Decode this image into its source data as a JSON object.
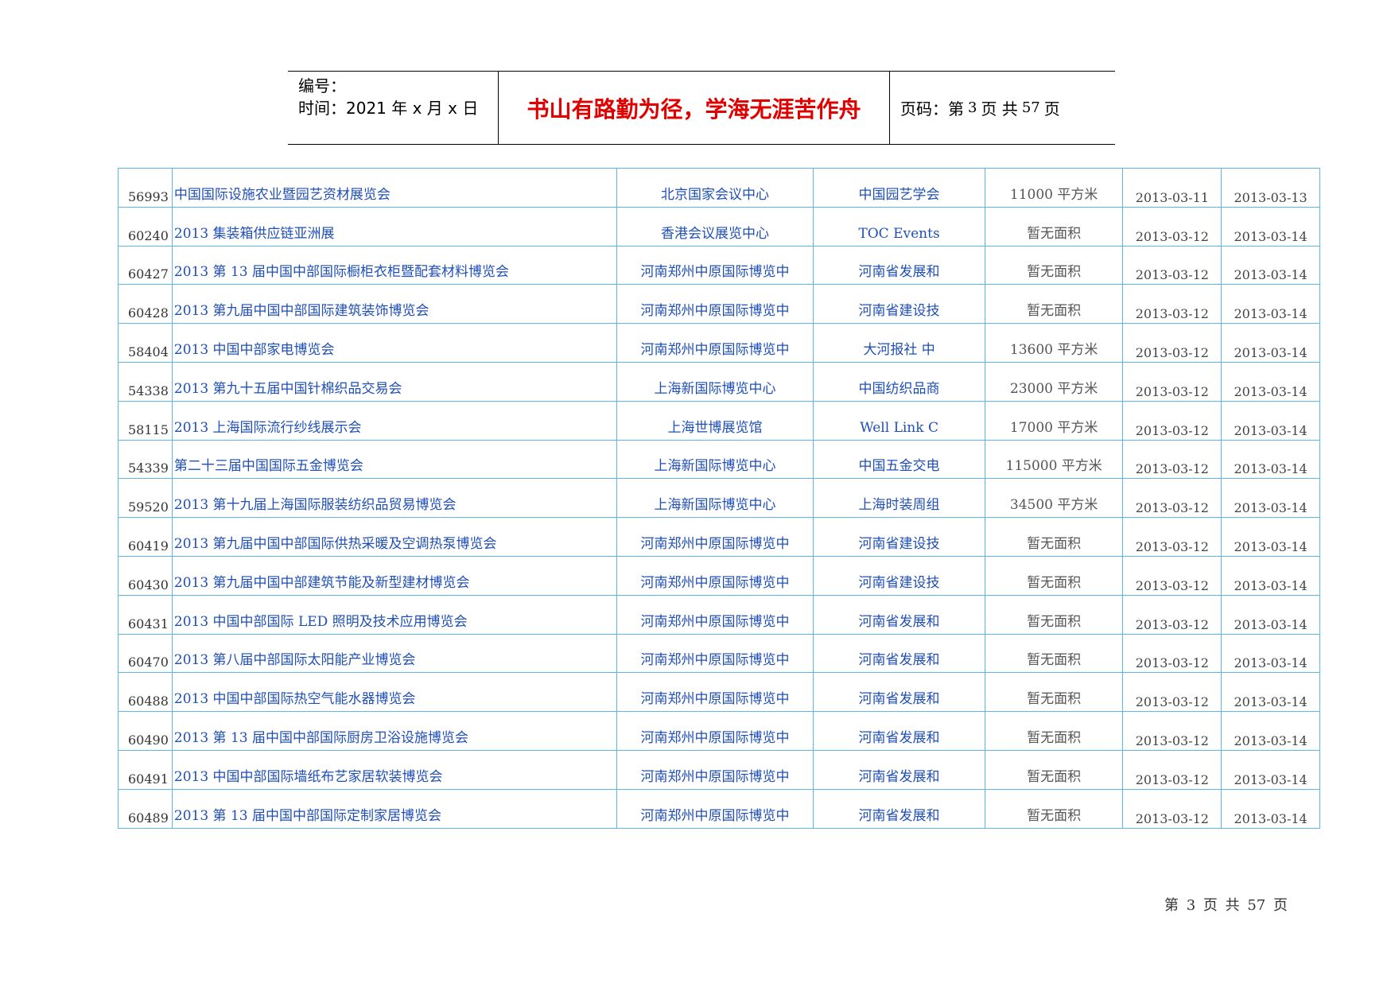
{
  "header": {
    "number_label": "编号：",
    "date_label": "时间：2021 年 x 月 x 日",
    "motto": "书山有路勤为径，学海无涯苦作舟",
    "page_prefix": "页码：第",
    "page_current": "3",
    "page_middle": "页  共",
    "page_total": "57",
    "page_suffix": "页"
  },
  "rows": [
    {
      "id": "56993",
      "name": "中国国际设施农业暨园艺资材展览会",
      "venue": "北京国家会议中心",
      "organizer": "中国园艺学会",
      "area": "11000 平方米",
      "start": "2013-03-11",
      "end": "2013-03-13"
    },
    {
      "id": "60240",
      "name": "2013 集装箱供应链亚洲展",
      "venue": "香港会议展览中心",
      "organizer": "TOC Events",
      "area": "暂无面积",
      "start": "2013-03-12",
      "end": "2013-03-14"
    },
    {
      "id": "60427",
      "name": "2013 第 13 届中国中部国际橱柜衣柜暨配套材料博览会",
      "venue": "河南郑州中原国际博览中",
      "organizer": "河南省发展和",
      "area": "暂无面积",
      "start": "2013-03-12",
      "end": "2013-03-14"
    },
    {
      "id": "60428",
      "name": "2013 第九届中国中部国际建筑装饰博览会",
      "venue": "河南郑州中原国际博览中",
      "organizer": "河南省建设技",
      "area": "暂无面积",
      "start": "2013-03-12",
      "end": "2013-03-14"
    },
    {
      "id": "58404",
      "name": "2013 中国中部家电博览会",
      "venue": "河南郑州中原国际博览中",
      "organizer": "大河报社  中",
      "area": "13600 平方米",
      "start": "2013-03-12",
      "end": "2013-03-14"
    },
    {
      "id": "54338",
      "name": "2013 第九十五届中国针棉织品交易会",
      "venue": "上海新国际博览中心",
      "organizer": "中国纺织品商",
      "area": "23000 平方米",
      "start": "2013-03-12",
      "end": "2013-03-14"
    },
    {
      "id": "58115",
      "name": "2013 上海国际流行纱线展示会",
      "venue": "上海世博展览馆",
      "organizer": "Well Link C",
      "area": "17000 平方米",
      "start": "2013-03-12",
      "end": "2013-03-14"
    },
    {
      "id": "54339",
      "name": "第二十三届中国国际五金博览会",
      "venue": "上海新国际博览中心",
      "organizer": "中国五金交电",
      "area": "115000 平方米",
      "start": "2013-03-12",
      "end": "2013-03-14"
    },
    {
      "id": "59520",
      "name": "2013 第十九届上海国际服装纺织品贸易博览会",
      "venue": "上海新国际博览中心",
      "organizer": "上海时装周组",
      "area": "34500 平方米",
      "start": "2013-03-12",
      "end": "2013-03-14"
    },
    {
      "id": "60419",
      "name": "2013 第九届中国中部国际供热采暖及空调热泵博览会",
      "venue": "河南郑州中原国际博览中",
      "organizer": "河南省建设技",
      "area": "暂无面积",
      "start": "2013-03-12",
      "end": "2013-03-14"
    },
    {
      "id": "60430",
      "name": "2013 第九届中国中部建筑节能及新型建材博览会",
      "venue": "河南郑州中原国际博览中",
      "organizer": "河南省建设技",
      "area": "暂无面积",
      "start": "2013-03-12",
      "end": "2013-03-14"
    },
    {
      "id": "60431",
      "name": "2013 中国中部国际 LED 照明及技术应用博览会",
      "venue": "河南郑州中原国际博览中",
      "organizer": "河南省发展和",
      "area": "暂无面积",
      "start": "2013-03-12",
      "end": "2013-03-14"
    },
    {
      "id": "60470",
      "name": "2013 第八届中部国际太阳能产业博览会",
      "venue": "河南郑州中原国际博览中",
      "organizer": "河南省发展和",
      "area": "暂无面积",
      "start": "2013-03-12",
      "end": "2013-03-14"
    },
    {
      "id": "60488",
      "name": "2013 中国中部国际热空气能水器博览会",
      "venue": "河南郑州中原国际博览中",
      "organizer": "河南省发展和",
      "area": "暂无面积",
      "start": "2013-03-12",
      "end": "2013-03-14"
    },
    {
      "id": "60490",
      "name": "2013 第 13 届中国中部国际厨房卫浴设施博览会",
      "venue": "河南郑州中原国际博览中",
      "organizer": "河南省发展和",
      "area": "暂无面积",
      "start": "2013-03-12",
      "end": "2013-03-14"
    },
    {
      "id": "60491",
      "name": "2013 中国中部国际墙纸布艺家居软装博览会",
      "venue": "河南郑州中原国际博览中",
      "organizer": "河南省发展和",
      "area": "暂无面积",
      "start": "2013-03-12",
      "end": "2013-03-14"
    },
    {
      "id": "60489",
      "name": "2013 第 13 届中国中部国际定制家居博览会",
      "venue": "河南郑州中原国际博览中",
      "organizer": "河南省发展和",
      "area": "暂无面积",
      "start": "2013-03-12",
      "end": "2013-03-14"
    }
  ],
  "footer": {
    "text": "第 3 页 共 57 页"
  }
}
